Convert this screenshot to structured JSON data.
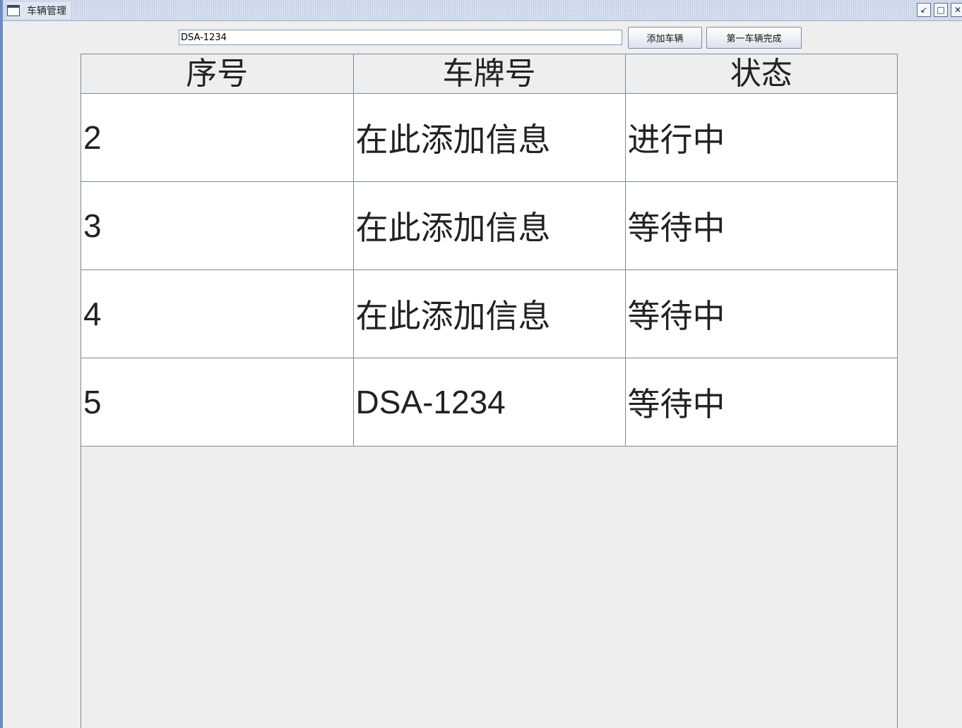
{
  "window": {
    "title": "车辆管理",
    "controls": [
      "restore-icon",
      "maximize-icon",
      "close-icon"
    ]
  },
  "toolbar": {
    "input_value": "DSA-1234",
    "add_button_label": "添加车辆",
    "done_button_label": "第一车辆完成"
  },
  "table": {
    "headers": [
      "序号",
      "车牌号",
      "状态"
    ],
    "rows": [
      [
        "2",
        "在此添加信息",
        "进行中"
      ],
      [
        "3",
        "在此添加信息",
        "等待中"
      ],
      [
        "4",
        "在此添加信息",
        "等待中"
      ],
      [
        "5",
        "DSA-1234",
        "等待中"
      ]
    ]
  }
}
